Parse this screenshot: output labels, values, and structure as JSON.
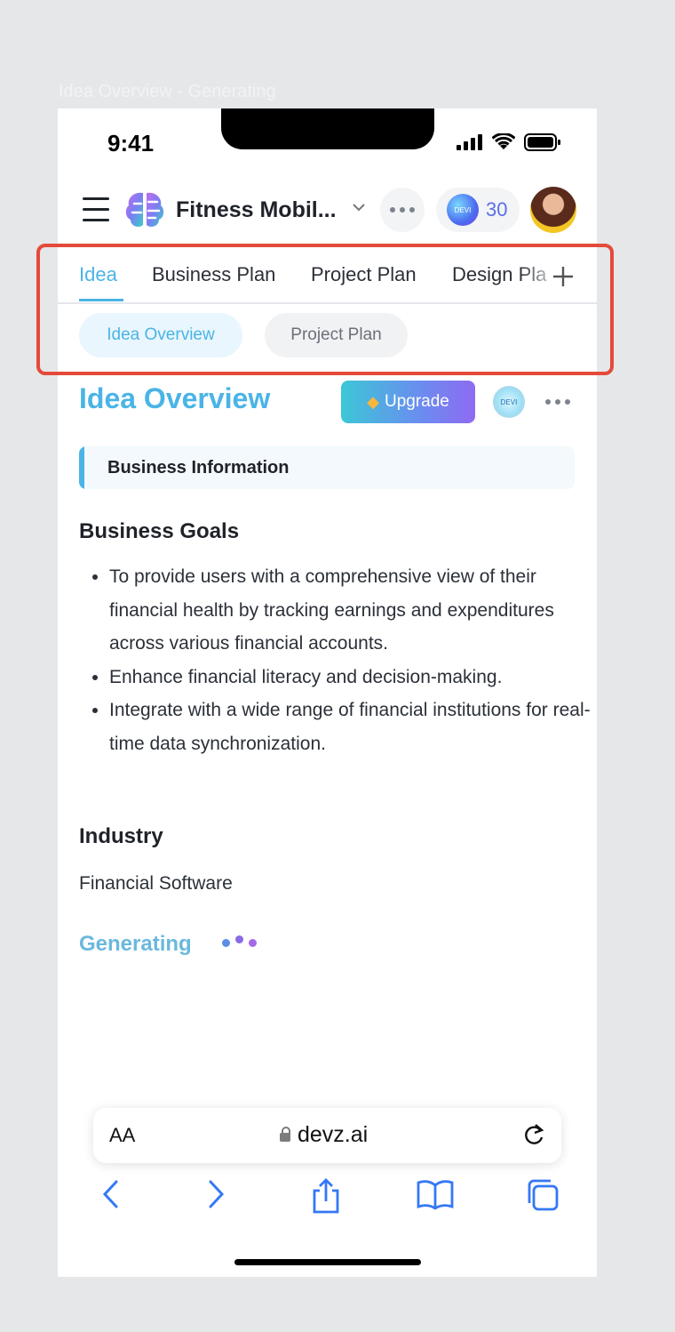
{
  "frame": {
    "label": "Idea Overview - Generating"
  },
  "status_bar": {
    "time": "9:41"
  },
  "header": {
    "project_name": "Fitness Mobil...",
    "credits": "30",
    "devi_label": "DEVI"
  },
  "tabs": [
    {
      "label": "Idea",
      "active": true
    },
    {
      "label": "Business Plan",
      "active": false
    },
    {
      "label": "Project Plan",
      "active": false
    },
    {
      "label": "Design Pla",
      "active": false
    }
  ],
  "subtabs": [
    {
      "label": "Idea Overview",
      "active": true
    },
    {
      "label": "Project Plan",
      "active": false
    }
  ],
  "content": {
    "title": "Idea Overview",
    "upgrade_label": "Upgrade",
    "section_title": "Business Information",
    "goals_heading": "Business Goals",
    "goals": [
      "To provide users with a comprehensive view of their financial health by tracking earnings and expenditures across various financial accounts.",
      "Enhance financial literacy and decision-making.",
      "Integrate with a wide range of financial institutions for real-time data synchronization."
    ],
    "industry_heading": "Industry",
    "industry_value": "Financial Software",
    "generating_label": "Generating"
  },
  "browser": {
    "text_size_label": "AA",
    "url": "devz.ai"
  },
  "colors": {
    "accent": "#4ab4e6",
    "highlight": "#e44a3a",
    "ios_blue": "#3478f6"
  }
}
